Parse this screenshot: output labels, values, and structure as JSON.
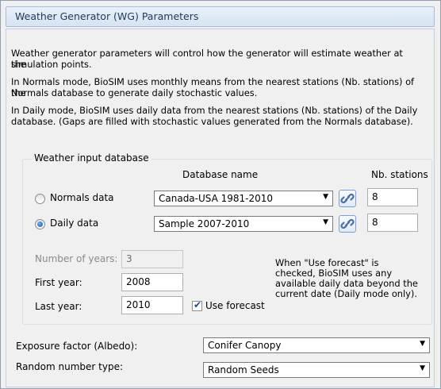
{
  "window": {
    "title": "Weather Generator (WG) Parameters"
  },
  "description": {
    "line1": "Weather generator parameters will control how the generator will estimate weather at the",
    "line2": "simulation points.",
    "line3": "In Normals mode, BioSIM uses monthly means from the nearest stations (Nb. stations) of the",
    "line4": "Normals database to generate daily stochastic values.",
    "line5": "In Daily mode, BioSIM uses daily data from the nearest stations (Nb. stations) of the Daily",
    "line6": "database. (Gaps are filled with stochastic values generated from the Normals database)."
  },
  "weather_input": {
    "group_title": "Weather input database",
    "col_database": "Database name",
    "col_stations": "Nb. stations",
    "normals": {
      "label": "Normals data",
      "selected": false,
      "database": "Canada-USA 1981-2010",
      "stations": "8"
    },
    "daily": {
      "label": "Daily data",
      "selected": true,
      "database": "Sample 2007-2010",
      "stations": "8"
    },
    "number_of_years_label": "Number of years:",
    "number_of_years": "3",
    "first_year_label": "First year:",
    "first_year": "2008",
    "last_year_label": "Last year:",
    "last_year": "2010",
    "use_forecast_label": "Use forecast",
    "use_forecast_checked": true,
    "forecast_note": {
      "line1": "When \"Use forecast\" is",
      "line2": "checked, BioSIM uses any",
      "line3": "available daily data beyond the",
      "line4": "current date (Daily mode only)."
    }
  },
  "exposure": {
    "label": "Exposure factor (Albedo):",
    "value": "Conifer Canopy"
  },
  "random": {
    "label": "Random number type:",
    "value": "Random Seeds"
  },
  "icons": {
    "combo_arrow": "chevron-down-icon",
    "link": "link-icon",
    "check": "checkmark-icon"
  },
  "colors": {
    "title_text": "#1e395b",
    "radio_selected": "#1c5fb8",
    "link_button_border": "#7aa0d4"
  }
}
